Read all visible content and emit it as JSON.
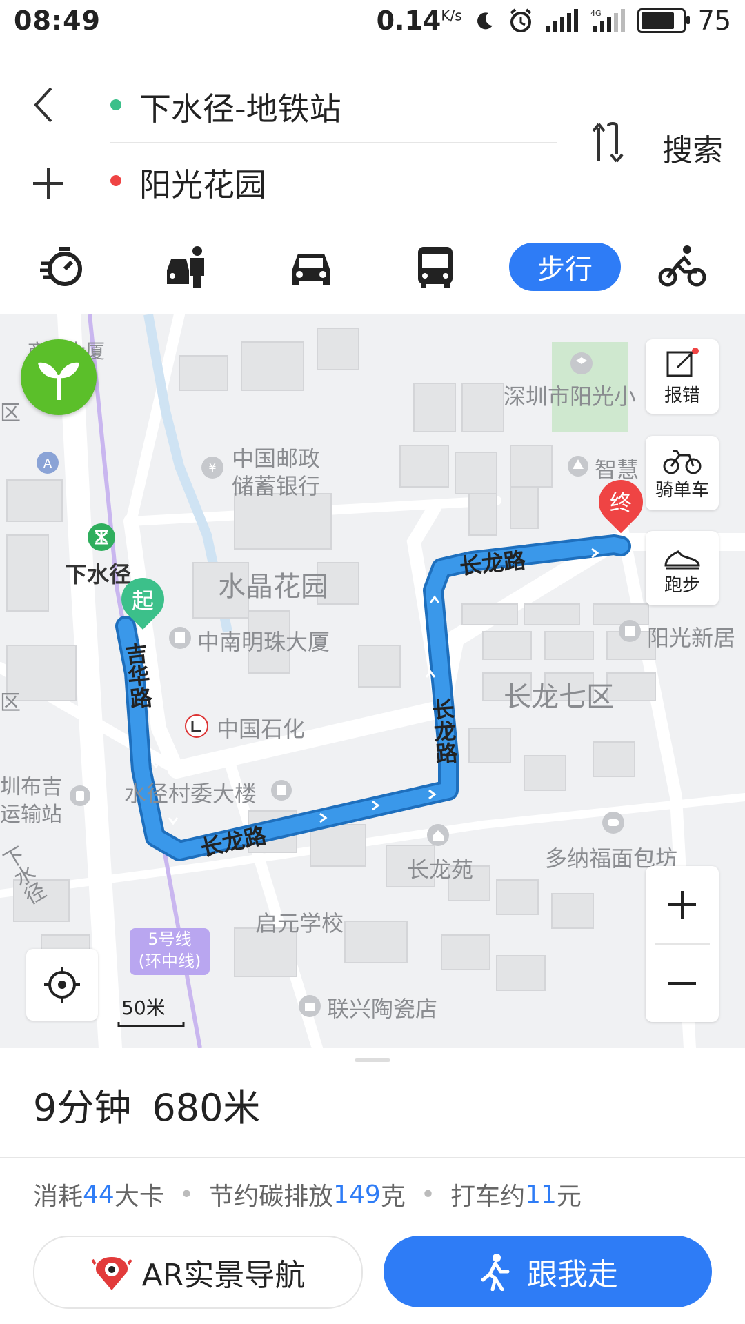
{
  "status_bar": {
    "time": "08:49",
    "net_speed": "0.14",
    "net_unit": "K/s",
    "battery": "75"
  },
  "route": {
    "start": "下水径-地铁站",
    "end": "阳光花园",
    "search_label": "搜索",
    "start_dot_color": "#3cc08a",
    "end_dot_color": "#ef4444"
  },
  "modes": {
    "active_label": "步行",
    "items": [
      "taxi-fast-icon",
      "carpool-icon",
      "car-icon",
      "bus-icon",
      "walk",
      "bike-icon"
    ]
  },
  "map": {
    "labels": {
      "commerce": "商业大厦",
      "district_left_top": "区",
      "postal_bank_1": "中国邮政",
      "postal_bank_2": "储蓄银行",
      "metro_station": "下水径",
      "crystal_garden": "水晶花园",
      "zhongnan": "中南明珠大厦",
      "sinopec": "中国石化",
      "village_office": "水径村委大楼",
      "yangguang_school": "深圳市阳光小",
      "zhihui": "智慧",
      "yangguang_xinju": "阳光新居",
      "changlong_7": "长龙七区",
      "changlong_yuan": "长龙苑",
      "duona_bakery": "多纳福面包坊",
      "qiyuan_school": "启元学校",
      "lianxing_ceramics": "联兴陶瓷店",
      "bus_station_1": "圳布吉",
      "bus_station_2": "运输站",
      "district_left_mid": "区",
      "xiashuijing_road": "下水径",
      "line5_1": "5号线",
      "line5_2": "(环中线)",
      "road_jihua": "吉华路",
      "road_changlong_top": "长龙路",
      "road_changlong_mid": "长龙路",
      "road_changlong_bottom": "长龙路",
      "start_marker": "起",
      "end_marker": "终",
      "scale": "50米"
    },
    "side_buttons": {
      "report": "报错",
      "bike": "骑单车",
      "run": "跑步"
    },
    "route_color": "#3a98ea"
  },
  "summary": {
    "time": "9分钟",
    "distance": "680米"
  },
  "stats": {
    "calories_prefix": "消耗",
    "calories_value": "44",
    "calories_suffix": "大卡",
    "carbon_prefix": "节约碳排放",
    "carbon_value": "149",
    "carbon_suffix": "克",
    "taxi_prefix": "打车约",
    "taxi_value": "11",
    "taxi_suffix": "元"
  },
  "actions": {
    "ar_label": "AR实景导航",
    "follow_label": "跟我走"
  }
}
